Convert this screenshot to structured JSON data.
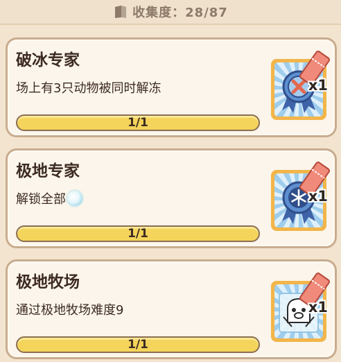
{
  "header": {
    "label": "收集度：28/87"
  },
  "achievements": [
    {
      "title": "破冰专家",
      "desc": "场上有3只动物被同时解冻",
      "progress_text": "1/1",
      "progress": 1.0,
      "reward_mult": "x1",
      "reward_icon": "ice-break-medal-icon"
    },
    {
      "title": "极地专家",
      "desc": "解锁全部",
      "progress_text": "1/1",
      "progress": 1.0,
      "reward_mult": "x1",
      "reward_icon": "snowflake-medal-icon"
    },
    {
      "title": "极地牧场",
      "desc": "通过极地牧场难度9",
      "progress_text": "1/1",
      "progress": 1.0,
      "reward_mult": "x1",
      "reward_icon": "frozen-animal-icon"
    }
  ],
  "colors": {
    "background": "#f3e4cf",
    "card_border": "#c8ac8f",
    "progress": "#f4d45a",
    "badge_frame": "#f2b54a",
    "ticket": "#f08a7a"
  }
}
